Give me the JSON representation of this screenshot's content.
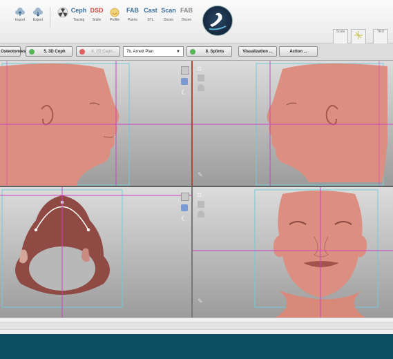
{
  "toolbar": {
    "buttons": [
      {
        "id": "import",
        "big": "",
        "label": "Import",
        "icon": "cloud-upload-icon"
      },
      {
        "id": "export",
        "big": "",
        "label": "Export",
        "icon": "cloud-download-icon"
      },
      {
        "id": "ceph",
        "big": "Ceph",
        "label": "Tracing",
        "icon": "ceph-icon"
      },
      {
        "id": "dsd",
        "big": "DSD",
        "label": "Smile",
        "icon": "dsd-icon"
      },
      {
        "id": "profile",
        "big": "",
        "label": "Profile",
        "icon": "profile-icon"
      },
      {
        "id": "fab",
        "big": "FAB",
        "label": "Points",
        "icon": "fab-icon"
      },
      {
        "id": "cast",
        "big": "Cast",
        "label": "STL",
        "icon": "cast-icon"
      },
      {
        "id": "scan",
        "big": "Scan",
        "label": "Dicom",
        "icon": "scan-icon"
      },
      {
        "id": "fab2",
        "big": "FAB",
        "label": "Dicom",
        "icon": "fab-icon"
      }
    ],
    "right_buttons": [
      {
        "id": "r1",
        "label": "Scale"
      },
      {
        "id": "r2",
        "label": ""
      },
      {
        "id": "r3",
        "label": "TRU"
      }
    ]
  },
  "steps": {
    "osteotomies": "Osteotomies",
    "coph": "5. 3D Coph",
    "ceph2d": "6. 2D Ceph...",
    "plan": "7b. Arnett Plan",
    "splints": "8. Splints",
    "visualization": "Visualization ...",
    "action": "Action ..."
  },
  "colors": {
    "step_ok": "#57b457",
    "step_warn": "#e06060",
    "skin": "#dc8f80",
    "crosshair": "#d040c0",
    "frame": "#6ecbd6",
    "taskbar": "#0d4f62"
  }
}
